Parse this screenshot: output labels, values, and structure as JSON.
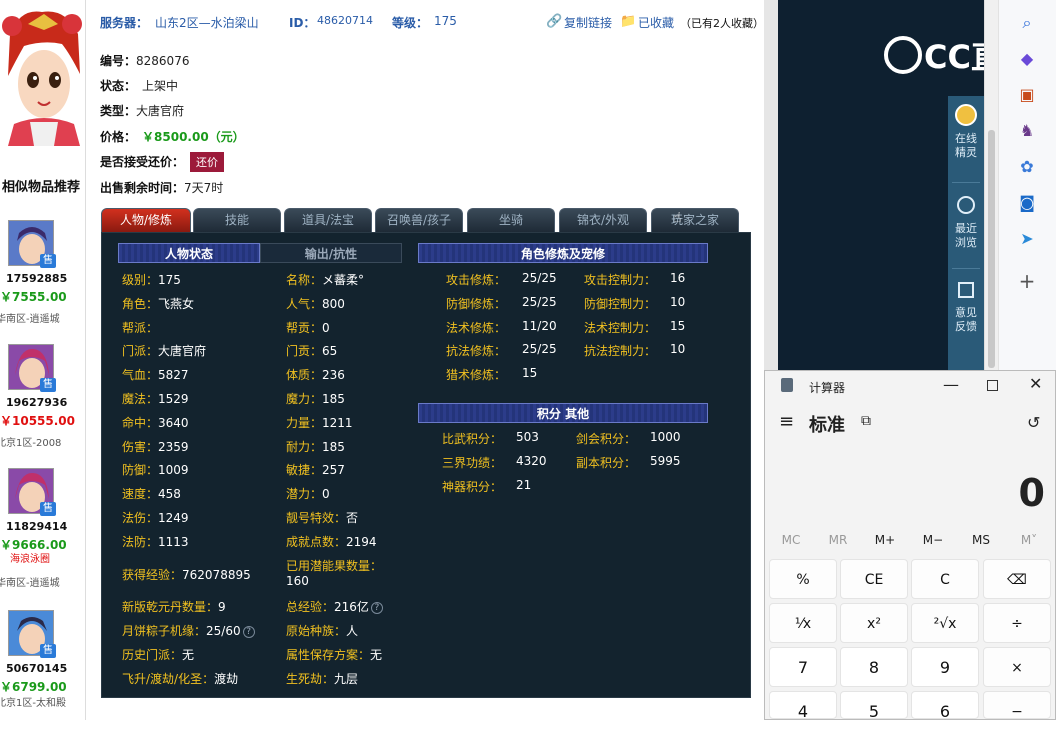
{
  "left": {
    "similar_title": "相似物品推荐",
    "items": [
      {
        "id": "17592885",
        "price": "￥7555.00",
        "server": "华南区-逍遥城",
        "tag": "售",
        "price_color": "green"
      },
      {
        "id": "19627936",
        "price": "￥10555.00",
        "server": "北京1区-2008",
        "tag": "售",
        "price_color": "red"
      },
      {
        "id": "11829414",
        "price": "￥9666.00",
        "server": "华南区-逍遥城",
        "note": "海浪泳圈",
        "tag": "售",
        "price_color": "green"
      },
      {
        "id": "50670145",
        "price": "￥6799.00",
        "server": "北京1区-太和殿",
        "tag": "售",
        "price_color": "green"
      }
    ]
  },
  "top": {
    "server_label": "服务器：",
    "server_value": "山东2区—水泊梁山",
    "id_label": "ID：",
    "id_value": "48620714",
    "level_label": "等级：",
    "level_value": "175",
    "copy_link": "复制链接",
    "favorited": "已收藏",
    "fav_count": "（已有2人收藏）"
  },
  "info": {
    "number_label": "编号：",
    "number_value": "8286076",
    "status_label": "状态：",
    "status_value": "上架中",
    "type_label": "类型：",
    "type_value": "大唐官府",
    "price_label": "价格：",
    "price_value": "￥8500.00（元）",
    "haggle_label": "是否接受还价：",
    "haggle_button": "还价",
    "remain_label": "出售剩余时间：",
    "remain_value": "7天7时"
  },
  "tabs": [
    "人物/修炼",
    "技能",
    "道具/法宝",
    "召唤兽/孩子",
    "坐骑",
    "锦衣/外观",
    "玩家之家"
  ],
  "panel": {
    "hdr_status": "人物状态",
    "hdr_output": "输出/抗性",
    "hdr_cultivation": "角色修炼及宠修",
    "hdr_points": "积分 其他",
    "col1": [
      [
        "级别：",
        "175"
      ],
      [
        "角色：",
        "飞燕女"
      ],
      [
        "帮派：",
        ""
      ],
      [
        "门派：",
        "大唐官府"
      ],
      [
        "气血：",
        "5827"
      ],
      [
        "魔法：",
        "1529"
      ],
      [
        "命中：",
        "3640"
      ],
      [
        "伤害：",
        "2359"
      ],
      [
        "防御：",
        "1009"
      ],
      [
        "速度：",
        "458"
      ],
      [
        "法伤：",
        "1249"
      ],
      [
        "法防：",
        "1113"
      ]
    ],
    "col2": [
      [
        "名称：",
        "メ蕃柔°"
      ],
      [
        "人气：",
        "800"
      ],
      [
        "帮贡：",
        "0"
      ],
      [
        "门贡：",
        "65"
      ],
      [
        "体质：",
        "236"
      ],
      [
        "魔力：",
        "185"
      ],
      [
        "力量：",
        "1211"
      ],
      [
        "耐力：",
        "185"
      ],
      [
        "敏捷：",
        "257"
      ],
      [
        "潜力：",
        "0"
      ],
      [
        "靓号特效：",
        "否"
      ],
      [
        "成就点数：",
        "2194"
      ]
    ],
    "exp_label": "获得经验：",
    "exp_value": "762078895",
    "potion_label": "已用潜能果数量：",
    "potion_value": "160",
    "qianyuan_label": "新版乾元丹数量：",
    "qianyuan_value": "9",
    "total_exp_label": "总经验：",
    "total_exp_value": "216亿",
    "zongzi_label": "月饼粽子机缘：",
    "zongzi_value": "25/60",
    "race_label": "原始种族：",
    "race_value": "人",
    "history_label": "历史门派：",
    "history_value": "无",
    "plan_label": "属性保存方案：",
    "plan_value": "无",
    "ascend_label": "飞升/渡劫/化圣：",
    "ascend_value": "渡劫",
    "life_label": "生死劫：",
    "life_value": "九层",
    "cult_left": [
      [
        "攻击修炼：",
        "25/25"
      ],
      [
        "防御修炼：",
        "25/25"
      ],
      [
        "法术修炼：",
        "11/20"
      ],
      [
        "抗法修炼：",
        "25/25"
      ],
      [
        "猎术修炼：",
        "15"
      ]
    ],
    "cult_right": [
      [
        "攻击控制力：",
        "16"
      ],
      [
        "防御控制力：",
        "10"
      ],
      [
        "法术控制力：",
        "15"
      ],
      [
        "抗法控制力：",
        "10"
      ]
    ],
    "points_left": [
      [
        "比武积分：",
        "503"
      ],
      [
        "三界功绩：",
        "4320"
      ],
      [
        "神器积分：",
        "21"
      ]
    ],
    "points_right": [
      [
        "剑会积分：",
        "1000"
      ],
      [
        "副本积分：",
        "5995"
      ]
    ]
  },
  "browser": {
    "logo": "CC直",
    "side_items": [
      "在线\n精灵",
      "最近\n浏览",
      "意见\n反馈"
    ]
  },
  "calculator": {
    "app_title": "计算器",
    "mode": "标准",
    "display": "0",
    "memory": [
      "MC",
      "MR",
      "M+",
      "M−",
      "MS",
      "M˅"
    ],
    "keys": [
      "%",
      "CE",
      "C",
      "⌫",
      "¹⁄x",
      "x²",
      "²√x",
      "÷",
      "7",
      "8",
      "9",
      "×",
      "4",
      "5",
      "6",
      "−"
    ]
  }
}
